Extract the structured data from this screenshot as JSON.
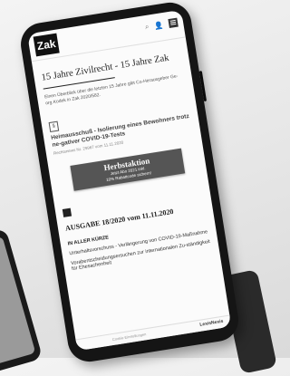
{
  "header": {
    "logo": "Zak",
    "icons": [
      "search-icon",
      "user-icon",
      "menu-icon"
    ]
  },
  "main": {
    "title": "15 Jahre Zivilrecht - 15 Jahre Zak",
    "teaser": "Einen Überblick über die letzten 15 Jahre gibt Co-Herausgeber Ge-org Kodek in Zak 2020/582.",
    "article": {
      "title": "Heimausschuß - Isolierung eines Bewohners trotz ne-gativer COVID-19-Tests",
      "meta": "Rechtsnews Nr. 29967 vom 11.11.2020"
    },
    "banner": {
      "heading": "Herbstaktion",
      "line1": "Jetzt Abo 2021 inkl.",
      "line2": "10% Rabattcode sichern!"
    },
    "issue_title": "AUSGABE 18/2020 vom 11.11.2020",
    "section": "IN ALLER KÜRZE",
    "items": [
      "Unterhaltsvorschuss - Verlängerung von COVID-19-Maßnahme",
      "Vorabentscheidungsersuchen zur internationalen Zu-ständigkeit für Ehesachenheit"
    ]
  },
  "footer": {
    "text": "Cookie-Einstellungen",
    "brand": "LexisNexis"
  }
}
